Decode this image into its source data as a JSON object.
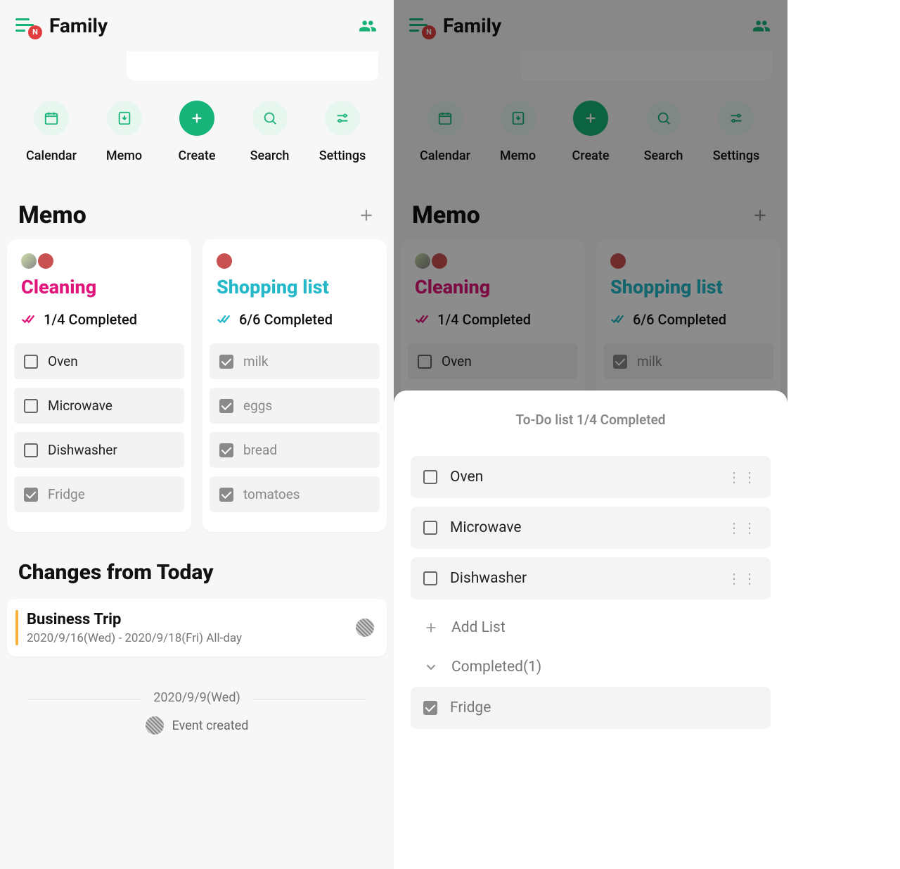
{
  "header": {
    "title": "Family",
    "badge": "N"
  },
  "nav": {
    "calendar": "Calendar",
    "memo": "Memo",
    "create": "Create",
    "search": "Search",
    "settings": "Settings"
  },
  "memo_section": {
    "title": "Memo"
  },
  "memo_cards": {
    "cleaning": {
      "title": "Cleaning",
      "completed": "1/4 Completed",
      "items": {
        "0": "Oven",
        "1": "Microwave",
        "2": "Dishwasher",
        "3": "Fridge"
      }
    },
    "shopping": {
      "title": "Shopping list",
      "completed": "6/6 Completed",
      "items": {
        "0": "milk",
        "1": "eggs",
        "2": "bread",
        "3": "tomatoes"
      }
    }
  },
  "changes": {
    "title": "Changes from Today",
    "event": {
      "name": "Business Trip",
      "time": "2020/9/16(Wed) - 2020/9/18(Fri) All-day"
    },
    "divider_date": "2020/9/9(Wed)",
    "created_label": "Event created"
  },
  "sheet": {
    "title": "To-Do list 1/4 Completed",
    "items": {
      "0": "Oven",
      "1": "Microwave",
      "2": "Dishwasher"
    },
    "add_list": "Add List",
    "completed_group": "Completed(1)",
    "completed_item": "Fridge"
  }
}
